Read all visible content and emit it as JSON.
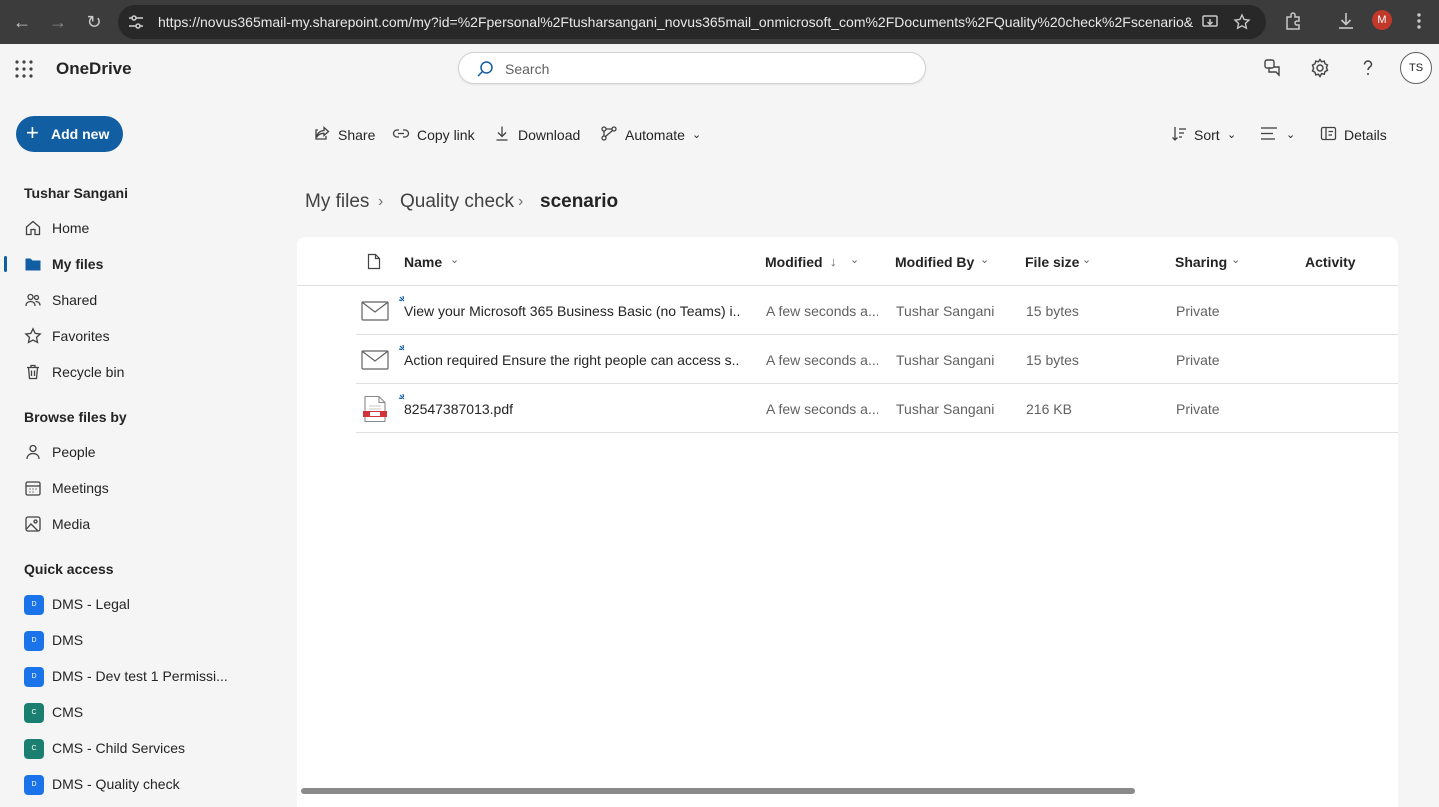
{
  "browser": {
    "url": "https://novus365mail-my.sharepoint.com/my?id=%2Fpersonal%2Ftusharsangani_novus365mail_onmicrosoft_com%2FDocuments%2FQuality%20check%2Fscenario&l...",
    "profile_initial": "M"
  },
  "header": {
    "app_name": "OneDrive",
    "search_placeholder": "Search",
    "user_initials": "TS"
  },
  "sidebar": {
    "add_new_label": "Add new",
    "user_name": "Tushar Sangani",
    "items": [
      {
        "label": "Home",
        "icon": "home-icon"
      },
      {
        "label": "My files",
        "icon": "folder-icon",
        "active": true
      },
      {
        "label": "Shared",
        "icon": "people-icon"
      },
      {
        "label": "Favorites",
        "icon": "star-icon"
      },
      {
        "label": "Recycle bin",
        "icon": "trash-icon"
      }
    ],
    "browse_heading": "Browse files by",
    "browse_items": [
      {
        "label": "People",
        "icon": "person-icon"
      },
      {
        "label": "Meetings",
        "icon": "calendar-icon"
      },
      {
        "label": "Media",
        "icon": "image-icon"
      }
    ],
    "quick_access_heading": "Quick access",
    "quick_access": [
      {
        "label": "DMS - Legal",
        "badge": "D",
        "color": "#1a73e8"
      },
      {
        "label": "DMS",
        "badge": "D",
        "color": "#1a73e8"
      },
      {
        "label": "DMS - Dev test 1 Permissi...",
        "badge": "D",
        "color": "#1a73e8"
      },
      {
        "label": "CMS",
        "badge": "C",
        "color": "#1a7f70"
      },
      {
        "label": "CMS - Child Services",
        "badge": "C",
        "color": "#1a7f70"
      },
      {
        "label": "DMS - Quality check",
        "badge": "D",
        "color": "#1a73e8"
      }
    ]
  },
  "toolbar": {
    "share": "Share",
    "copy_link": "Copy link",
    "download": "Download",
    "automate": "Automate",
    "sort": "Sort",
    "details": "Details"
  },
  "breadcrumb": [
    "My files",
    "Quality check",
    "scenario"
  ],
  "table": {
    "columns": [
      "Name",
      "Modified",
      "Modified By",
      "File size",
      "Sharing",
      "Activity"
    ],
    "rows": [
      {
        "icon": "email-icon",
        "name": "View your Microsoft 365 Business Basic (no Teams) i...",
        "modified": "A few seconds a...",
        "modified_by": "Tushar Sangani",
        "size": "15 bytes",
        "sharing": "Private"
      },
      {
        "icon": "email-icon",
        "name": "Action required Ensure the right people can access s...",
        "modified": "A few seconds a...",
        "modified_by": "Tushar Sangani",
        "size": "15 bytes",
        "sharing": "Private"
      },
      {
        "icon": "pdf-icon",
        "name": "82547387013.pdf",
        "modified": "A few seconds a...",
        "modified_by": "Tushar Sangani",
        "size": "216 KB",
        "sharing": "Private"
      }
    ]
  }
}
